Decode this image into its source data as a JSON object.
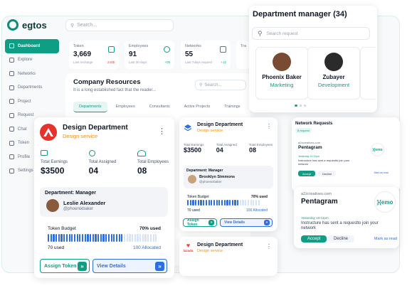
{
  "app": {
    "logo": "egtos",
    "search_placeholder": "Search..."
  },
  "sidebar": {
    "items": [
      {
        "label": "Dashboard",
        "active": true
      },
      {
        "label": "Explore"
      },
      {
        "label": "Networks"
      },
      {
        "label": "Departments"
      },
      {
        "label": "Project"
      },
      {
        "label": "Request"
      },
      {
        "label": "Chat"
      },
      {
        "label": "Token"
      },
      {
        "label": "Profile"
      },
      {
        "label": "Settings"
      }
    ]
  },
  "stats": [
    {
      "label": "Token",
      "value": "3,669",
      "sub": "Last recharge",
      "change": "244$"
    },
    {
      "label": "Employees",
      "value": "91",
      "sub": "Last 30 days",
      "change": "+09"
    },
    {
      "label": "Networks",
      "value": "55",
      "sub": "Last 7days request",
      "change": "+12"
    },
    {
      "label": "Tra",
      "value": "",
      "sub": "",
      "change": ""
    }
  ],
  "resources": {
    "title": "Company Resources",
    "description": "It is a long established fact that the reader...",
    "search_placeholder": "Search...",
    "tabs": [
      "Departments",
      "Employees",
      "Consultants",
      "Active Projects",
      "Trainings"
    ]
  },
  "dept_manager": {
    "title": "Department manager (34)",
    "search_placeholder": "Search request",
    "people": [
      {
        "name": "Phoenix Baker",
        "role": "Marketing"
      },
      {
        "name": "Zubayer",
        "role": "Development"
      }
    ]
  },
  "design_big": {
    "name": "Design Department",
    "type": "Design service",
    "stats": [
      {
        "label": "Total Earnings",
        "value": "$3500"
      },
      {
        "label": "Total Assigned",
        "value": "04"
      },
      {
        "label": "Total Employees",
        "value": "08"
      }
    ],
    "manager_heading": "Department: Manager",
    "manager_name": "Leslie Alexander",
    "manager_handle": "@phoenixbaker",
    "budget_label": "Token Budget",
    "budget_pct": "70% used",
    "budget_fill": 0.7,
    "used": "70 used",
    "allocated": "100 Allocated",
    "assign_label": "Assign Token",
    "view_label": "View Details"
  },
  "design_small": {
    "name": "Design Department",
    "type": "Design service",
    "stats": [
      {
        "label": "Total Earnings",
        "value": "$3500"
      },
      {
        "label": "Total Assigned",
        "value": "04"
      },
      {
        "label": "Total Employees",
        "value": "08"
      }
    ],
    "manager_heading": "Department: Manager",
    "manager_name": "Brooklyn Simmons",
    "manager_handle": "@phoenixbaker",
    "budget_label": "Token Budget",
    "budget_pct": "70% used",
    "budget_fill": 0.7,
    "used": "70 used",
    "allocated": "100 Allocated",
    "assign_label": "Assign Token",
    "view_label": "View Details"
  },
  "design_third": {
    "brand": "lazada",
    "name": "Design Department",
    "type": "Design service"
  },
  "network": {
    "title": "Network Requests",
    "badge": "8 request",
    "small": {
      "site": "a2zcreatives.com",
      "name": "Pentagram",
      "time": "Yesterday 10:12pm",
      "msg": "Instructure has sent a requestto join your network",
      "accept": "Accept",
      "decline": "Decline",
      "read": "Mark as read",
      "logo": "}{emo"
    },
    "big": {
      "site": "a2zcreatives.com",
      "name": "Pentagram",
      "time": "Yesterday 10:12pm",
      "msg": "Instructure has sent a requestto join your network",
      "accept": "Accept",
      "decline": "Decline",
      "read": "Mark as read",
      "logo": "}{emo"
    }
  },
  "colors": {
    "accent": "#0e9e84",
    "blue": "#2e6fe0",
    "orange": "#f79009"
  }
}
